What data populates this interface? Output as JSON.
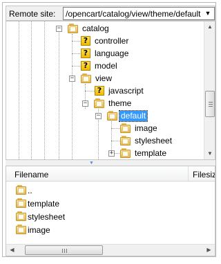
{
  "remote_site": {
    "label": "Remote site:",
    "path": "/opencart/catalog/view/theme/default"
  },
  "tree": {
    "nodes": [
      {
        "label": "catalog",
        "icon": "folder-icon"
      },
      {
        "label": "controller",
        "icon": "unknown-folder-icon"
      },
      {
        "label": "language",
        "icon": "unknown-folder-icon"
      },
      {
        "label": "model",
        "icon": "unknown-folder-icon"
      },
      {
        "label": "view",
        "icon": "folder-icon"
      },
      {
        "label": "javascript",
        "icon": "unknown-folder-icon"
      },
      {
        "label": "theme",
        "icon": "folder-icon"
      },
      {
        "label": "default",
        "icon": "folder-icon",
        "selected": true
      },
      {
        "label": "image",
        "icon": "folder-icon"
      },
      {
        "label": "stylesheet",
        "icon": "folder-icon"
      },
      {
        "label": "template",
        "icon": "folder-icon"
      }
    ],
    "expand_glyph": "−",
    "collapse_glyph": "+",
    "unknown_glyph": "?"
  },
  "file_list": {
    "columns": [
      "Filename",
      "Filesiz"
    ],
    "rows": [
      {
        "name": ".."
      },
      {
        "name": "template"
      },
      {
        "name": "stylesheet"
      },
      {
        "name": "image"
      }
    ]
  },
  "colors": {
    "selection": "#3399ff",
    "folder": "#f2c95a"
  }
}
